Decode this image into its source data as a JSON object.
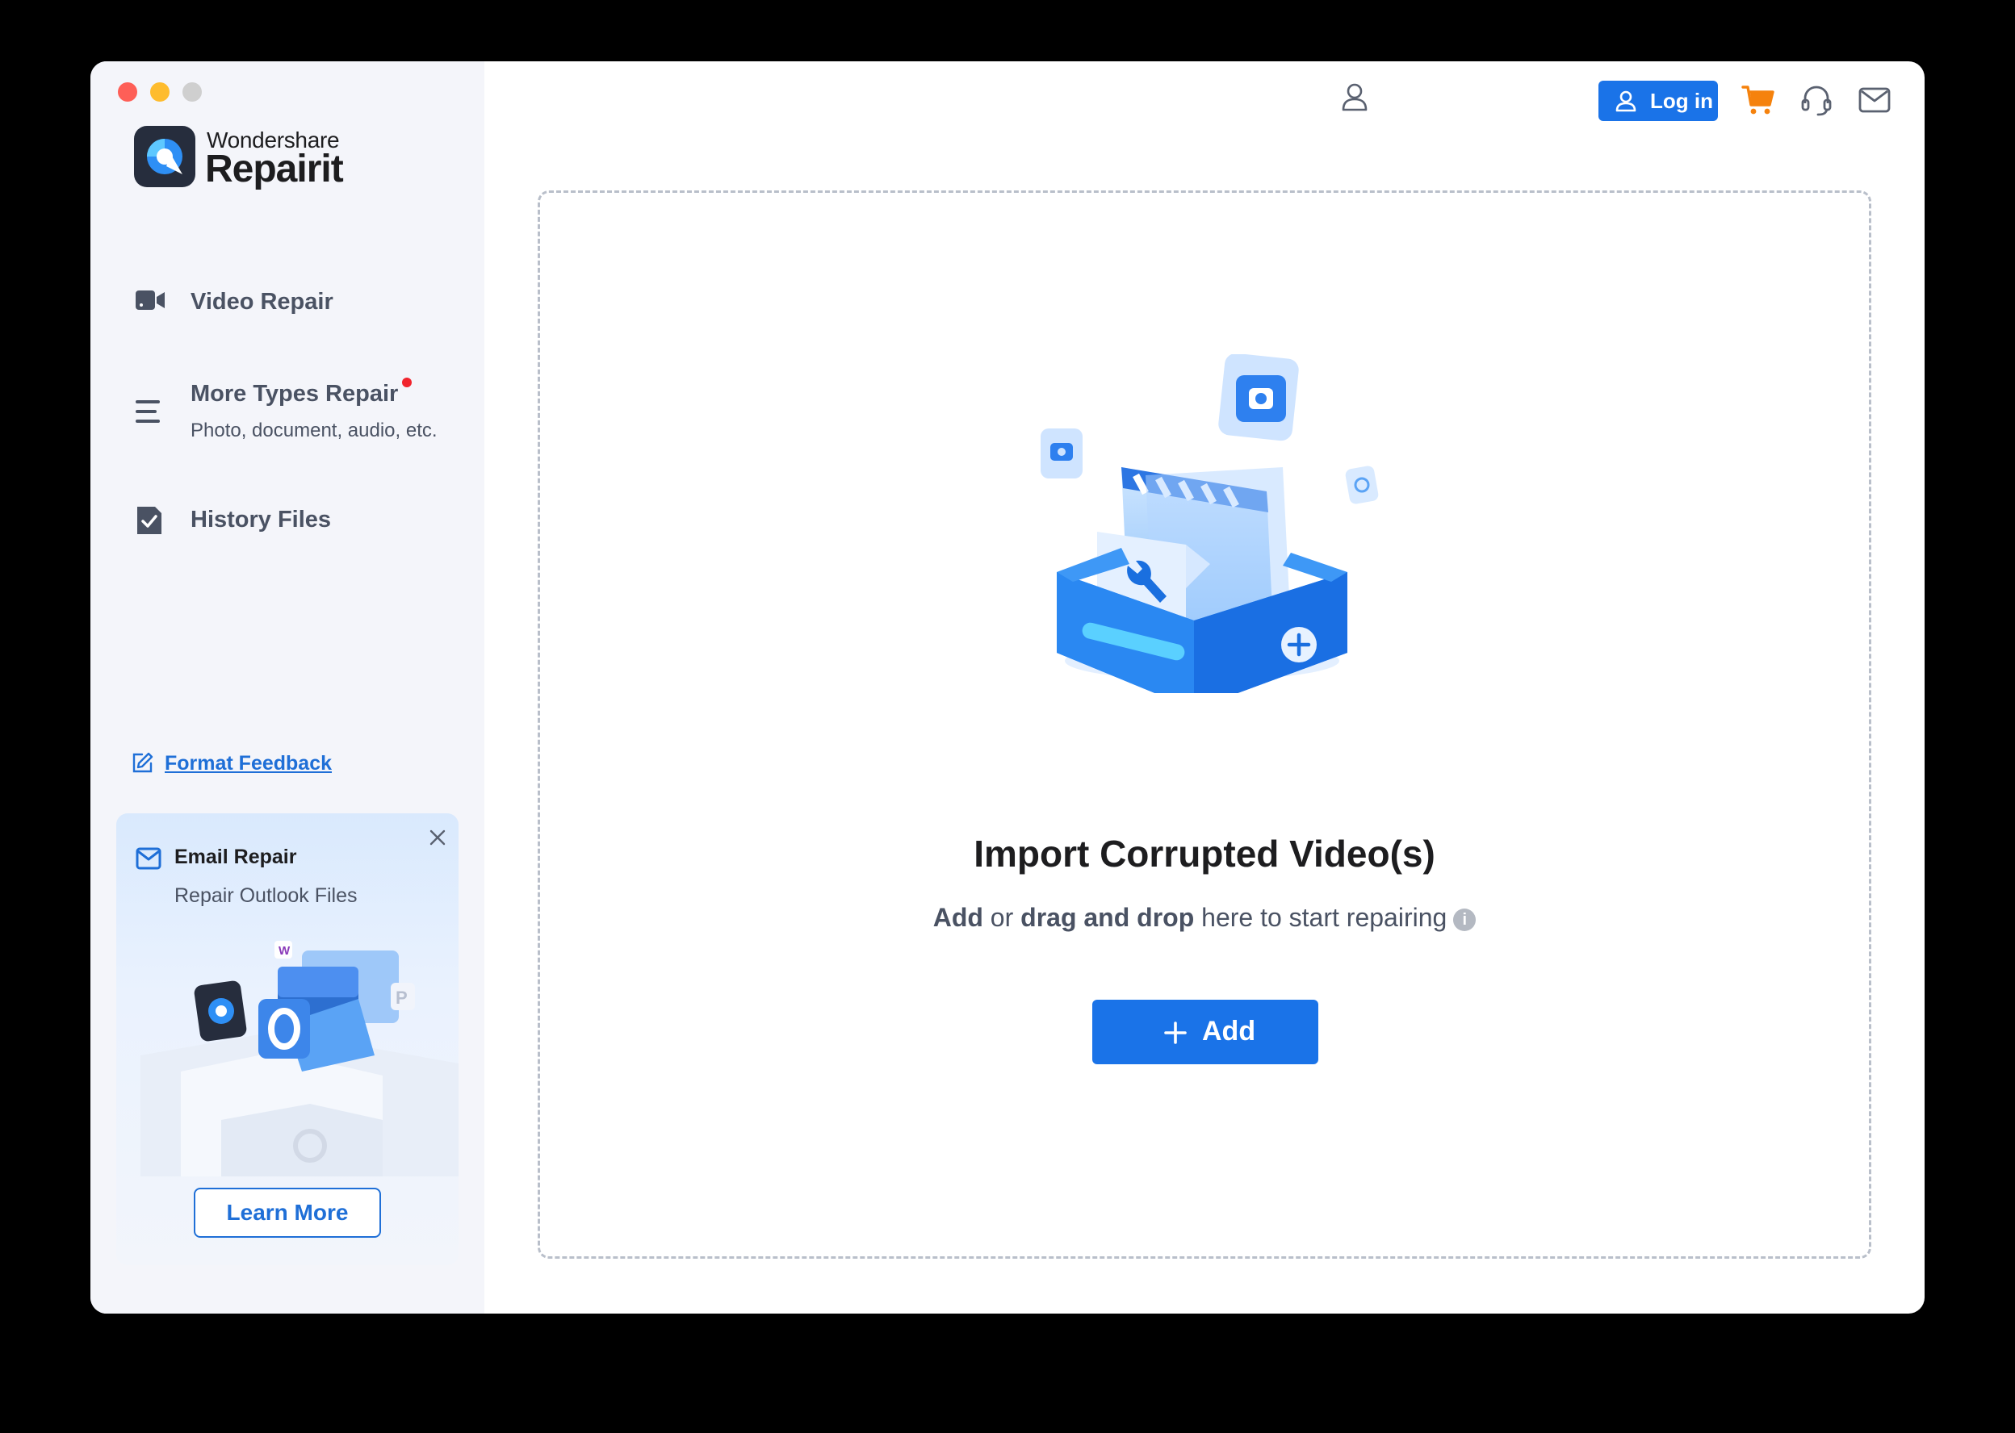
{
  "app": {
    "brand_line1": "Wondershare",
    "brand_line2": "Repairit"
  },
  "sidebar": {
    "items": [
      {
        "label": "Video Repair",
        "icon": "video-camera-icon"
      },
      {
        "label": "More Types Repair",
        "sublabel": "Photo, document, audio, etc.",
        "icon": "menu-lines-icon",
        "has_new_badge": true
      },
      {
        "label": "History Files",
        "icon": "file-check-icon"
      }
    ],
    "feedback_label": "Format Feedback",
    "promo": {
      "title": "Email Repair",
      "subtitle": "Repair Outlook Files",
      "button_label": "Learn More"
    }
  },
  "header": {
    "login_label": "Log in",
    "icons": [
      "user-icon",
      "cart-icon",
      "headset-icon",
      "mail-icon"
    ]
  },
  "main": {
    "title": "Import Corrupted Video(s)",
    "subtitle_part1": "Add",
    "subtitle_part2": " or ",
    "subtitle_part3": "drag and drop",
    "subtitle_part4": " here to start repairing",
    "add_label": "Add"
  },
  "colors": {
    "accent": "#1a73e8",
    "sidebar_bg": "#f4f5fa",
    "badge_red": "#f1242d",
    "cart_orange": "#f5820d"
  }
}
